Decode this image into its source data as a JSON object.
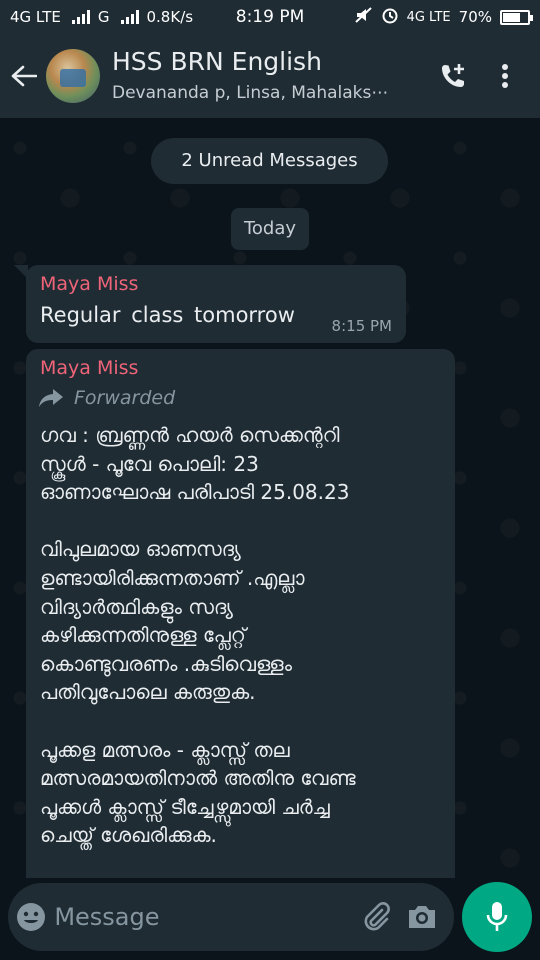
{
  "status_bar": {
    "net1": "4G LTE",
    "net2": "G",
    "speed": "0.8K/s",
    "time": "8:19 PM",
    "net3": "4G LTE",
    "battery": "70%",
    "battery_level": 0.7
  },
  "header": {
    "title": "HSS BRN English",
    "subtitle": "Devananda p, Linsa, Mahalaks⋯"
  },
  "chat": {
    "unread_label": "2 Unread Messages",
    "day_label": "Today",
    "messages": [
      {
        "sender": "Maya Miss",
        "text": "Regular  class  tomorrow",
        "time": "8:15 PM"
      },
      {
        "sender": "Maya Miss",
        "forwarded_label": "Forwarded",
        "text": "ഗവ : ബ്രണ്ണൻ ഹയർ സെക്കന്ററി\nസ്കൂൾ - പൂവേ പൊലി: 23\nഓണാഘോഷ പരിപാടി 25.08.23\n\nവിപുലമായ ഓണസദ്യ\nഉണ്ടായിരിക്കുന്നതാണ് .എല്ലാ\nവിദ്യാർത്ഥികളും സദ്യ\nകഴിക്കുന്നതിനുള്ള പ്ലേറ്റ്\nകൊണ്ടുവരണം .കുടിവെള്ളം\nപതിവുപോലെ കരുതുക.\n\nപൂക്കള മത്സരം - ക്ലാസ്സ് തല\nമത്സരമായതിനാൽ അതിനു വേണ്ട\nപൂക്കൾ ക്ലാസ്സ് ടീച്ചേഴ്സുമായി ചർച്ച\nചെയ്ത് ശേഖരിക്കുക."
      }
    ]
  },
  "input": {
    "placeholder": "Message"
  },
  "icons": {
    "back": "arrow-left-icon",
    "add_call": "phone-plus-icon",
    "menu": "more-vertical-icon",
    "emoji": "emoji-icon",
    "attach": "paperclip-icon",
    "camera": "camera-icon",
    "mic": "mic-icon",
    "forward": "forward-arrow-icon"
  },
  "colors": {
    "accent": "#00a884",
    "sender_name": "#ef6478",
    "bubble": "#1f2c34",
    "background": "#0b141a"
  }
}
